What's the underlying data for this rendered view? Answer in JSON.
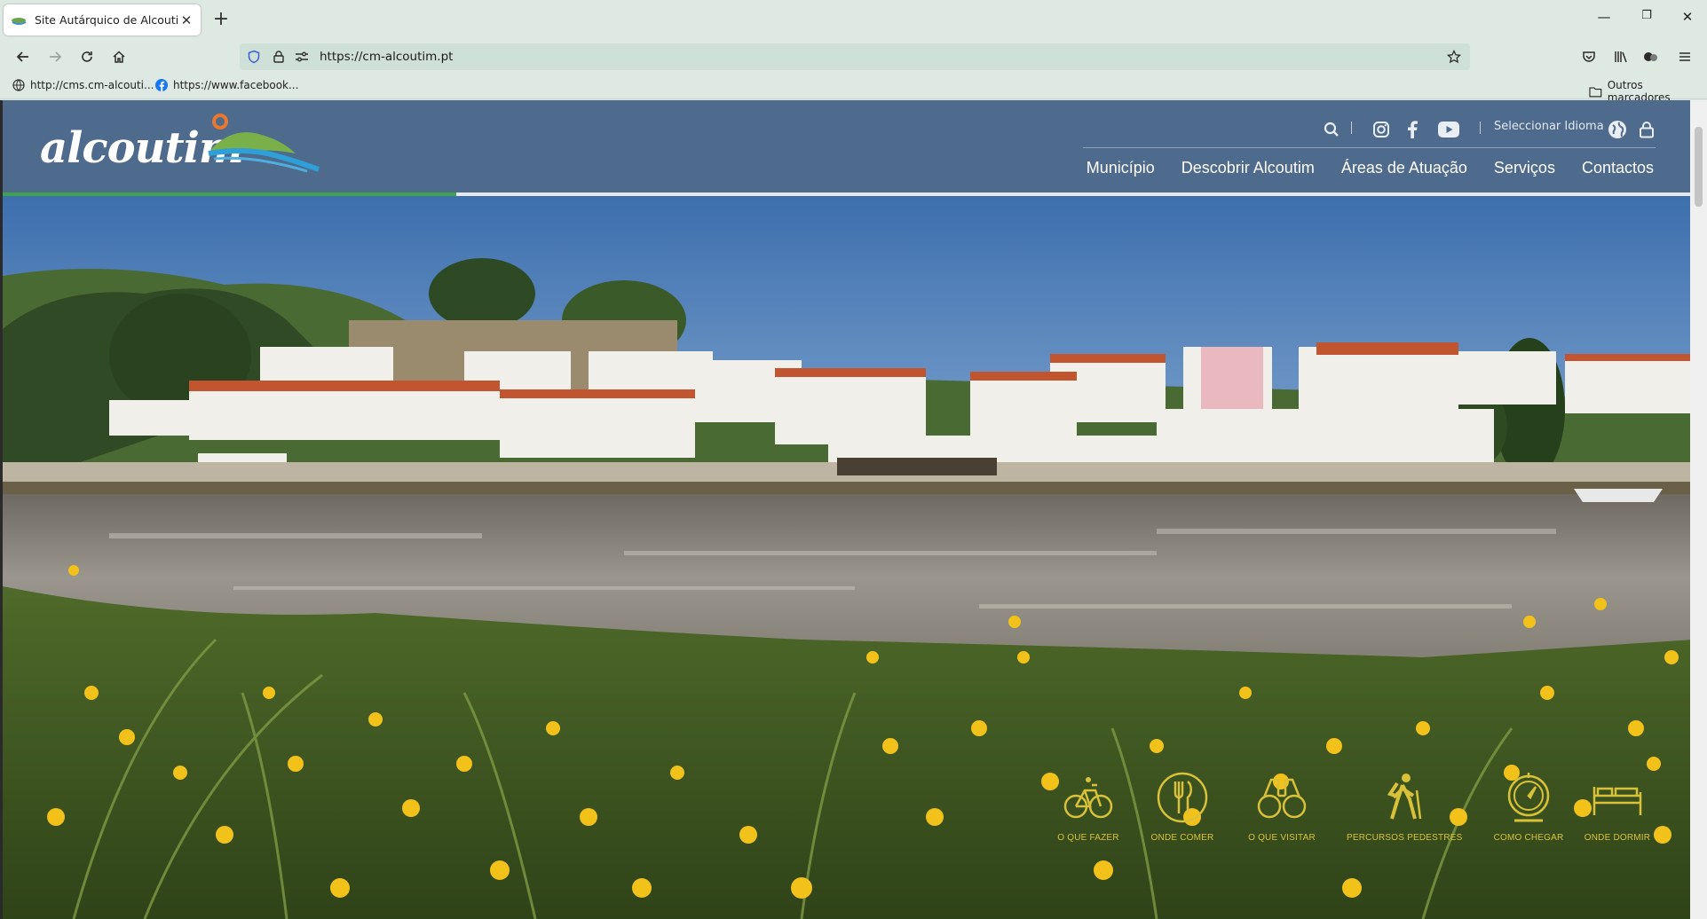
{
  "browser": {
    "tab": {
      "title": "Site Autárquico de Alcoutim",
      "close": "✕"
    },
    "new_tab": "+",
    "window_controls": {
      "minimize": "—",
      "restore": "❐",
      "close": "✕"
    },
    "url": "https://cm-alcoutim.pt",
    "bookmarks": [
      {
        "label": "http://cms.cm-alcouti...",
        "icon": "globe-icon"
      },
      {
        "label": "https://www.facebook...",
        "icon": "facebook-icon"
      }
    ],
    "other_bookmarks": "Outros marcadores"
  },
  "site": {
    "logo": "alcoutim",
    "language_label": "Seleccionar Idioma",
    "menu": [
      "Município",
      "Descobrir Alcoutim",
      "Áreas de Atuação",
      "Serviços",
      "Contactos"
    ],
    "quick_links": [
      {
        "label": "O QUE FAZER",
        "icon": "bicycle-icon"
      },
      {
        "label": "ONDE COMER",
        "icon": "cutlery-icon"
      },
      {
        "label": "O QUE VISITAR",
        "icon": "binoculars-icon"
      },
      {
        "label": "PERCURSOS PEDESTRES",
        "icon": "hiker-icon"
      },
      {
        "label": "COMO CHEGAR",
        "icon": "compass-icon"
      },
      {
        "label": "ONDE DORMIR",
        "icon": "bed-icon"
      }
    ],
    "colors": {
      "header": "#4e6a8c",
      "accent_green": "#3fa34a",
      "quick_link": "#d9c23a"
    }
  }
}
